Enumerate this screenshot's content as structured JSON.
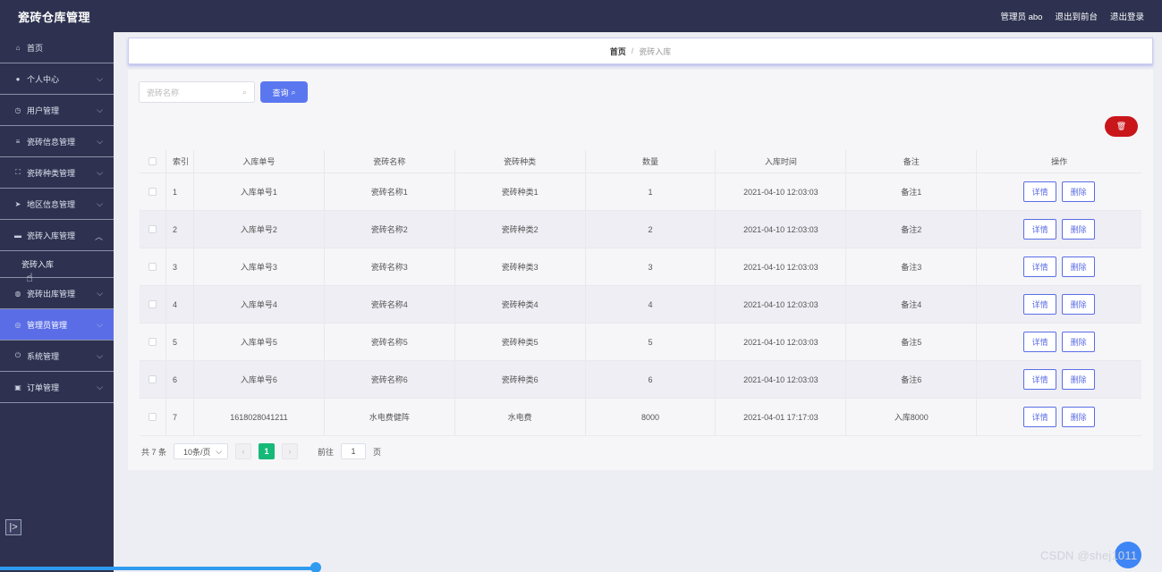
{
  "app": {
    "title": "瓷砖仓库管理",
    "user_label": "管理员 abo",
    "to_frontend": "退出到前台",
    "logout": "退出登录"
  },
  "sidebar": {
    "items": [
      {
        "label": "首页",
        "icon": "home-icon",
        "chevron": false
      },
      {
        "label": "个人中心",
        "icon": "user-icon",
        "chevron": true
      },
      {
        "label": "用户管理",
        "icon": "clock-icon",
        "chevron": true
      },
      {
        "label": "瓷砖信息管理",
        "icon": "list-icon",
        "chevron": true
      },
      {
        "label": "瓷砖种类管理",
        "icon": "frame-icon",
        "chevron": true
      },
      {
        "label": "地区信息管理",
        "icon": "send-icon",
        "chevron": true
      },
      {
        "label": "瓷砖入库管理",
        "icon": "monitor-icon",
        "chevron": true,
        "expanded": true
      },
      {
        "label": "瓷砖出库管理",
        "icon": "globe-icon",
        "chevron": true
      },
      {
        "label": "管理员管理",
        "icon": "compass-icon",
        "chevron": true,
        "active": true
      },
      {
        "label": "系统管理",
        "icon": "power-icon",
        "chevron": true
      },
      {
        "label": "订单管理",
        "icon": "doc-icon",
        "chevron": true
      }
    ],
    "submenu": {
      "label": "瓷砖入库"
    },
    "toggle_glyph": "|>"
  },
  "breadcrumb": {
    "home": "首页",
    "separator": "/",
    "current": "瓷砖入库"
  },
  "search": {
    "placeholder": "瓷砖名称",
    "button_label": "查询"
  },
  "table": {
    "headers": [
      "索引",
      "入库单号",
      "瓷砖名称",
      "瓷砖种类",
      "数量",
      "入库时间",
      "备注",
      "操作"
    ],
    "rows": [
      [
        "1",
        "入库单号1",
        "瓷砖名称1",
        "瓷砖种类1",
        "1",
        "2021-04-10 12:03:03",
        "备注1"
      ],
      [
        "2",
        "入库单号2",
        "瓷砖名称2",
        "瓷砖种类2",
        "2",
        "2021-04-10 12:03:03",
        "备注2"
      ],
      [
        "3",
        "入库单号3",
        "瓷砖名称3",
        "瓷砖种类3",
        "3",
        "2021-04-10 12:03:03",
        "备注3"
      ],
      [
        "4",
        "入库单号4",
        "瓷砖名称4",
        "瓷砖种类4",
        "4",
        "2021-04-10 12:03:03",
        "备注4"
      ],
      [
        "5",
        "入库单号5",
        "瓷砖名称5",
        "瓷砖种类5",
        "5",
        "2021-04-10 12:03:03",
        "备注5"
      ],
      [
        "6",
        "入库单号6",
        "瓷砖名称6",
        "瓷砖种类6",
        "6",
        "2021-04-10 12:03:03",
        "备注6"
      ],
      [
        "7",
        "1618028041211",
        "水电费健阵",
        "水电费",
        "8000",
        "2021-04-01 17:17:03",
        "入库8000"
      ]
    ],
    "detail_label": "详情",
    "delete_label": "删除"
  },
  "pagination": {
    "total": "共 7 条",
    "page_size": "10条/页",
    "current_page": "1",
    "goto_prefix": "前往",
    "goto_value": "1",
    "goto_suffix": "页"
  },
  "watermark": "CSDN @shej1011",
  "colors": {
    "sidebar_bg": "#2e3250",
    "accent": "#5b6de6",
    "danger": "#c9161b",
    "pager_active": "#17b978"
  }
}
